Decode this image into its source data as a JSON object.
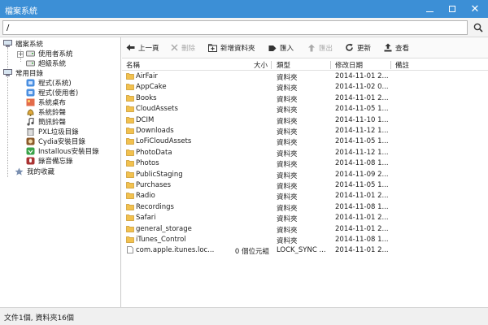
{
  "window": {
    "title": "檔案系統"
  },
  "path": {
    "value": "/"
  },
  "tree": {
    "file_system": "檔案系統",
    "user_system": "使用者系統",
    "root_system": "超級系統",
    "common": "常用目錄",
    "items": [
      "程式(系統)",
      "程式(使用者)",
      "系統桌布",
      "系統鈴聲",
      "簡訊鈴聲",
      "PXL垃圾目錄",
      "Cydia安裝目錄",
      "Installous安裝目錄",
      "錄音備忘錄"
    ],
    "favorites": "我的收藏"
  },
  "toolbar": {
    "back": "上一頁",
    "delete": "刪除",
    "new_folder": "新增資料夾",
    "import": "匯入",
    "export": "匯出",
    "refresh": "更新",
    "view": "查看"
  },
  "columns": {
    "name": "名稱",
    "size": "大小",
    "type": "類型",
    "modified": "修改日期",
    "note": "備註"
  },
  "files": [
    {
      "name": "AirFair",
      "size": "",
      "type": "資料夾",
      "date": "2014-11-01 2..."
    },
    {
      "name": "AppCake",
      "size": "",
      "type": "資料夾",
      "date": "2014-11-02 0..."
    },
    {
      "name": "Books",
      "size": "",
      "type": "資料夾",
      "date": "2014-11-01 2..."
    },
    {
      "name": "CloudAssets",
      "size": "",
      "type": "資料夾",
      "date": "2014-11-05 1..."
    },
    {
      "name": "DCIM",
      "size": "",
      "type": "資料夾",
      "date": "2014-11-10 1..."
    },
    {
      "name": "Downloads",
      "size": "",
      "type": "資料夾",
      "date": "2014-11-12 1..."
    },
    {
      "name": "LoFiCloudAssets",
      "size": "",
      "type": "資料夾",
      "date": "2014-11-05 1..."
    },
    {
      "name": "PhotoData",
      "size": "",
      "type": "資料夾",
      "date": "2014-11-12 1..."
    },
    {
      "name": "Photos",
      "size": "",
      "type": "資料夾",
      "date": "2014-11-08 1..."
    },
    {
      "name": "PublicStaging",
      "size": "",
      "type": "資料夾",
      "date": "2014-11-09 2..."
    },
    {
      "name": "Purchases",
      "size": "",
      "type": "資料夾",
      "date": "2014-11-05 1..."
    },
    {
      "name": "Radio",
      "size": "",
      "type": "資料夾",
      "date": "2014-11-01 2..."
    },
    {
      "name": "Recordings",
      "size": "",
      "type": "資料夾",
      "date": "2014-11-08 1..."
    },
    {
      "name": "Safari",
      "size": "",
      "type": "資料夾",
      "date": "2014-11-01 2..."
    },
    {
      "name": "general_storage",
      "size": "",
      "type": "資料夾",
      "date": "2014-11-01 2..."
    },
    {
      "name": "iTunes_Control",
      "size": "",
      "type": "資料夾",
      "date": "2014-11-08 1..."
    },
    {
      "name": "com.apple.itunes.loc...",
      "size": "0 個位元組",
      "type": "LOCK_SYNC ...",
      "date": "2014-11-01 2..."
    }
  ],
  "status": {
    "text": "文件1個, 資料夾16個"
  },
  "colors": {
    "titlebar": "#3c8fd6",
    "folder": "#f2c14e"
  }
}
